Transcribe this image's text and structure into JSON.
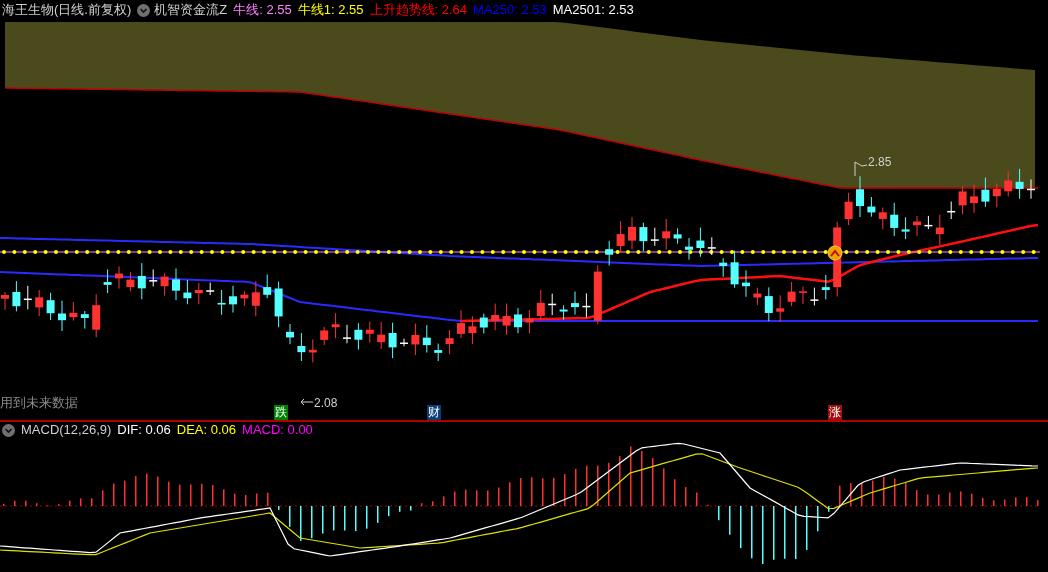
{
  "header": {
    "title": "海王生物(日线.前复权)",
    "indicator": "机智资金流Z",
    "values": [
      {
        "label": "牛线:",
        "value": "2.55",
        "color": "#ff80ff"
      },
      {
        "label": "牛线1:",
        "value": "2.55",
        "color": "#ffff00"
      },
      {
        "label": "上升趋势线:",
        "value": "2.64",
        "color": "#ff0000"
      },
      {
        "label": "MA250:",
        "value": "2.53",
        "color": "#0000ff"
      },
      {
        "label": "MA2501:",
        "value": "2.53",
        "color": "#ffffff"
      }
    ]
  },
  "main_chart": {
    "high_label": "2.85",
    "low_label": "2.08",
    "note": "用到未来数据",
    "markers": [
      {
        "text": "跌",
        "color": "#008000"
      },
      {
        "text": "财",
        "color": "#0a3c78"
      },
      {
        "text": "涨",
        "color": "#a01010"
      }
    ]
  },
  "macd": {
    "title": "MACD(12,26,9)",
    "values": [
      {
        "label": "DIF:",
        "value": "0.06",
        "color": "#ffffff"
      },
      {
        "label": "DEA:",
        "value": "0.06",
        "color": "#ffff00"
      },
      {
        "label": "MACD:",
        "value": "0.00",
        "color": "#ff00ff"
      }
    ]
  }
}
